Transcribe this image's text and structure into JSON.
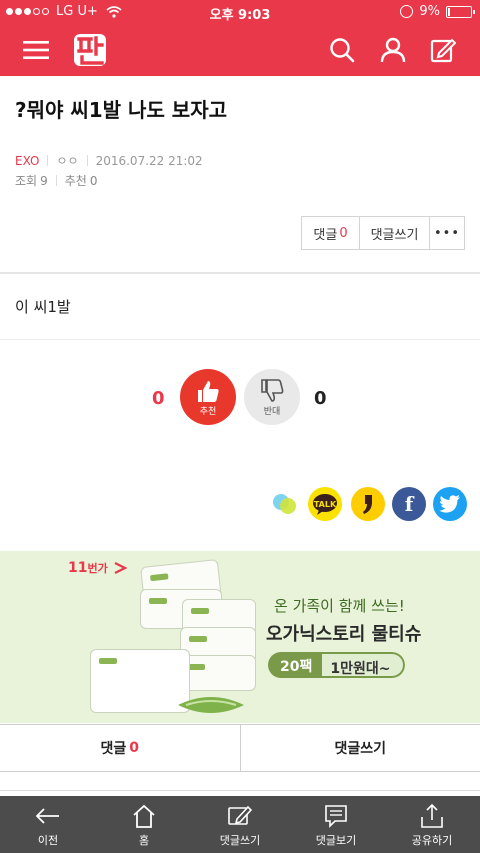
{
  "status_bar": {
    "carrier": "LG U+",
    "time": "오후 9:03",
    "battery_text": "9%",
    "battery_level": 0.09
  },
  "header": {
    "logo_text": "판",
    "icons": [
      "menu-icon",
      "search-icon",
      "user-icon",
      "write-icon"
    ]
  },
  "article": {
    "title": "?뭐야 씨1발 나도 보자고",
    "board": "EXO",
    "author": "ㅇㅇ",
    "date": "2016.07.22 21:02",
    "views_label": "조회",
    "views": "9",
    "recommend_label": "추천",
    "recommend": "0",
    "body": "이 씨1발"
  },
  "actions": {
    "comment_label": "댓글",
    "comment_count": "0",
    "write_label": "댓글쓰기",
    "more_label": "•••"
  },
  "vote": {
    "up_count": "0",
    "up_label": "추천",
    "down_label": "반대",
    "down_count": "0"
  },
  "share": [
    "band-icon",
    "kakaotalk-icon",
    "kakaostory-icon",
    "facebook-icon",
    "twitter-icon"
  ],
  "share_labels": {
    "talk": "TALK",
    "fb": "f"
  },
  "ad": {
    "brand": "11",
    "brand_suffix": "번가",
    "line1": "온 가족이 함께 쓰는!",
    "line2": "오가닉스토리 물티슈",
    "pill_left": "20팩",
    "pill_right": "1만원대~"
  },
  "comment_bar": {
    "comment_label": "댓글",
    "comment_count": "0",
    "write_label": "댓글쓰기"
  },
  "tabbar": [
    {
      "label": "이전",
      "icon": "back-arrow-icon"
    },
    {
      "label": "홈",
      "icon": "home-icon"
    },
    {
      "label": "댓글쓰기",
      "icon": "write-comment-icon"
    },
    {
      "label": "댓글보기",
      "icon": "view-comments-icon"
    },
    {
      "label": "공유하기",
      "icon": "share-icon"
    }
  ]
}
